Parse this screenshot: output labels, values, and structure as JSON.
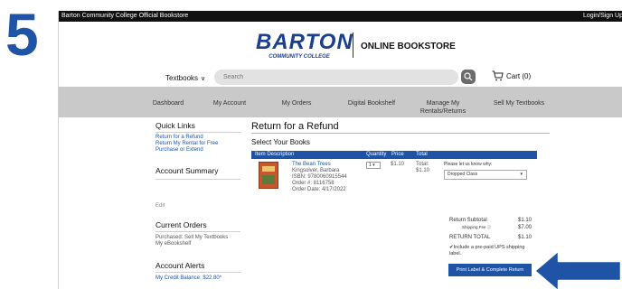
{
  "step": "5",
  "topbar": {
    "store_name": "Barton Community College Official Bookstore",
    "login": "Login/Sign Up"
  },
  "header": {
    "logo_word": "BARTON",
    "logo_sub": "COMMUNITY COLLEGE",
    "logo_right": "ONLINE BOOKSTORE",
    "textbooks_label": "Textbooks",
    "search_placeholder": "Search",
    "cart_label": "Cart (0)"
  },
  "nav": {
    "items": [
      {
        "label": "Dashboard"
      },
      {
        "label": "My Account"
      },
      {
        "label": "My Orders"
      },
      {
        "label": "Digital Bookshelf"
      },
      {
        "line1": "Manage My",
        "line2": "Rentals/Returns"
      },
      {
        "label": "Sell My Textbooks"
      }
    ]
  },
  "sidebar": {
    "quick_links_title": "Quick Links",
    "links": [
      "Return for a Refund",
      "Return My Rental for Free",
      "Purchase or Extend"
    ],
    "account_summary_title": "Account Summary",
    "edit": "Edit",
    "current_orders_title": "Current Orders",
    "orders": [
      "Purchased: Sell My Textbooks",
      "My eBookshelf"
    ],
    "alerts_title": "Account Alerts",
    "credit": "My Credit Balance: $22.80*"
  },
  "main": {
    "title": "Return for a Refund",
    "subtitle": "Select Your Books",
    "columns": [
      "Item Description",
      "Quantity",
      "Price",
      "Total"
    ],
    "book": {
      "title": "The Bean Trees",
      "author": "Kingsolver, Barbara",
      "isbn": "ISBN: 9780060915544",
      "order": "Order #: 8116758",
      "order_date": "Order Date: 4/17/2022",
      "qty": "1",
      "price": "$1.10",
      "total_label": "Total:",
      "total_value": "$1.10"
    },
    "reason_label": "Please let us know why:",
    "reason_value": "Dropped Class",
    "summary": {
      "subtotal_label": "Return Subtotal",
      "subtotal_value": "$1.10",
      "shipping_label": "Shipping Fee",
      "shipping_value": "$7.00",
      "total_label": "RETURN TOTAL",
      "total_value": "$1.10"
    },
    "ups_text": "Include a pre-paid UPS shipping label.",
    "print_button": "Print Label & Complete Return"
  },
  "colors": {
    "brand_blue": "#1e53a5",
    "nav_gray": "#c9c9c9"
  }
}
